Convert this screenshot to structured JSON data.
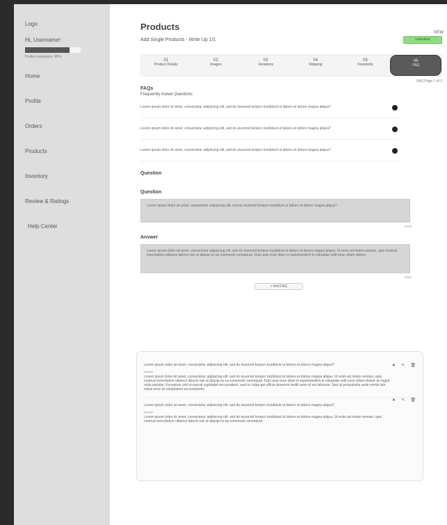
{
  "sidebar": {
    "logo": "Logo",
    "user": "Hi, Username!",
    "progress_fraction": 0.8,
    "profile_status": "Profile completion: 80%",
    "items": [
      {
        "label": "Home"
      },
      {
        "label": "Profile"
      },
      {
        "label": "Orders"
      },
      {
        "label": "Products"
      },
      {
        "label": "Inventory"
      },
      {
        "label": "Review & Ratings"
      },
      {
        "label": "Help Center"
      }
    ]
  },
  "page": {
    "title": "Products",
    "subtitle": "Add Single Products - Write Up 1/1",
    "badge_tag": "NEW",
    "badge_label": "Submitted",
    "badge_color": "#8fe07d"
  },
  "tabs": [
    {
      "num": "01",
      "label": "Product Details"
    },
    {
      "num": "02",
      "label": "Images"
    },
    {
      "num": "03",
      "label": "Variations"
    },
    {
      "num": "04",
      "label": "Shipping"
    },
    {
      "num": "05",
      "label": "Keywords"
    },
    {
      "num": "06",
      "label": "FAQ"
    }
  ],
  "tabs_meta": "FAQ Page 1 of 3",
  "faqs": {
    "title": "FAQs",
    "subtitle": "Frequently Asked Questions",
    "items": [
      {
        "text": "Lorem ipsum dolor sit amet, consectetur adipiscing elit, sed do eiusmod tempor incididunt ut labore et dolore magna aliqua?"
      },
      {
        "text": "Lorem ipsum dolor sit amet, consectetur adipiscing elit, sed do eiusmod tempor incididunt ut labore et dolore magna aliqua?"
      },
      {
        "text": "Lorem ipsum dolor sit amet, consectetur adipiscing elit, sed do eiusmod tempor incididunt ut labore et dolore magna aliqua?"
      }
    ]
  },
  "form": {
    "heading": "Question",
    "question_label": "Question",
    "question_value": "Lorem ipsum dolor sit amet, consectetur adipiscing elit, sed do eiusmod tempor incididunt ut labore et dolore magna aliqua?",
    "question_count": "0/150",
    "answer_label": "Answer",
    "answer_value": "Lorem ipsum dolor sit amet, consectetur adipiscing elit, sed do eiusmod tempor incididunt ut labore et dolore magna aliqua. Ut enim ad minim veniam, quis nostrud exercitation ullamco laboris nisi ut aliquip ex ea commodo consequat. Duis aute irure dolor in reprehenderit in voluptate velit esse cillum dolore.",
    "answer_count": "0/500",
    "add_button": "+ Add FAQ"
  },
  "card": {
    "answer_label": "Answer",
    "items": [
      {
        "question": "Lorem ipsum dolor sit amet, consectetur adipiscing elit, sed do eiusmod tempor incididunt ut labore et dolore magna aliqua?",
        "answer": "Lorem ipsum dolor sit amet, consectetur adipiscing elit, sed do eiusmod tempor incididunt ut labore et dolore magna aliqua. Ut enim ad minim veniam, quis nostrud exercitation ullamco laboris nisi ut aliquip ex ea commodo consequat. Duis aute irure dolor in reprehenderit in voluptate velit esse cillum dolore eu fugiat nulla pariatur. Excepteur sint occaecat cupidatat non proident, sunt in culpa qui officia deserunt mollit anim id est laborum. Sed ut perspiciatis unde omnis iste natus error sit voluptatem accusantium."
      },
      {
        "question": "Lorem ipsum dolor sit amet, consectetur adipiscing elit, sed do eiusmod tempor incididunt ut labore et dolore magna aliqua?",
        "answer": "Lorem ipsum dolor sit amet, consectetur adipiscing elit, sed do eiusmod tempor incididunt ut labore et dolore magna aliqua. Ut enim ad minim veniam, quis nostrud exercitation ullamco laboris nisi ut aliquip ex ea commodo consequat."
      }
    ]
  }
}
